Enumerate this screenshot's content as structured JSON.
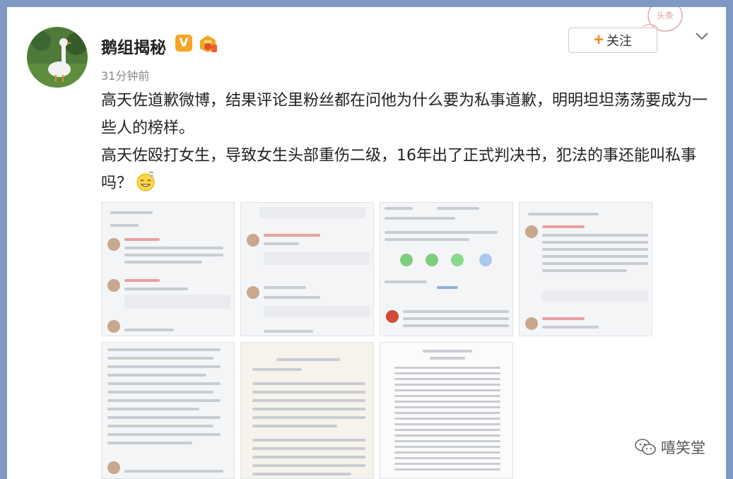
{
  "post": {
    "username": "鹅组揭秘",
    "verified_badge": "V",
    "timestamp": "31分钟前",
    "follow_label": "关注",
    "paragraphs": [
      "高天佐道歉微博，结果评论里粉丝都在问他为什么要为私事道歉，明明坦坦荡荡要成为一些人的榜样。",
      "高天佐殴打女生，导致女生头部重伤二级，16年出了正式判决书，犯法的事还能叫私事吗？"
    ],
    "emoji_name": "sweat-smile-emoji"
  },
  "watermark": {
    "text": "嘻笑堂",
    "icon": "wechat-icon"
  },
  "stamp": {
    "text": "头条"
  },
  "colors": {
    "background": "#7f98c4",
    "follow_plus": "#f28c2a",
    "vbadge": "#f5a623",
    "card": "#ffffff"
  }
}
